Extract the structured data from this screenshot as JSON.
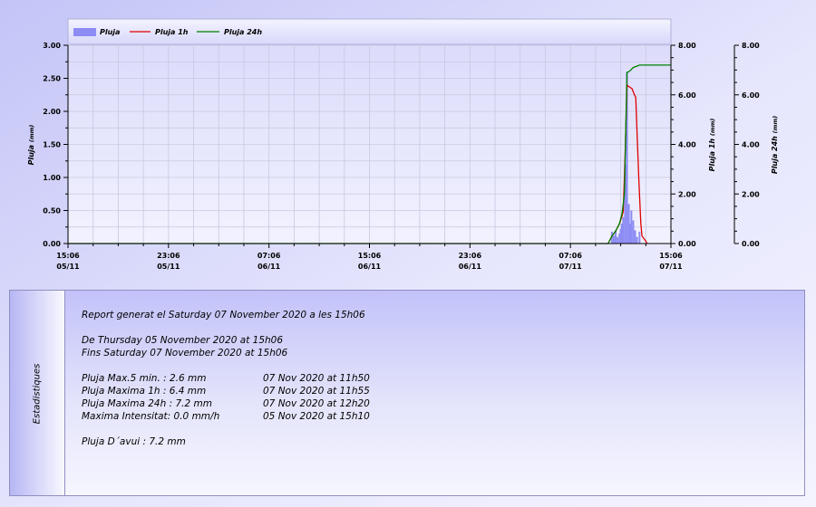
{
  "colors": {
    "bars": "#8c8cf4",
    "rain_1h": "#e00000",
    "rain_24h": "#008000",
    "grid": "#c8c8e0"
  },
  "chart_data": {
    "type": "bar+line",
    "x_tick_labels": [
      {
        "time": "15:06",
        "date": "05/11",
        "h": 0
      },
      {
        "time": "23:06",
        "date": "05/11",
        "h": 8
      },
      {
        "time": "07:06",
        "date": "06/11",
        "h": 16
      },
      {
        "time": "15:06",
        "date": "06/11",
        "h": 24
      },
      {
        "time": "23:06",
        "date": "06/11",
        "h": 32
      },
      {
        "time": "07:06",
        "date": "07/11",
        "h": 40
      },
      {
        "time": "15:06",
        "date": "07/11",
        "h": 48
      }
    ],
    "xlim_hours": [
      0,
      48
    ],
    "axes": [
      {
        "id": "left",
        "ylabel": "Pluja",
        "unit": "(mm)",
        "ylim": [
          0,
          3
        ],
        "ticks": [
          "0.00",
          "0.50",
          "1.00",
          "1.50",
          "2.00",
          "2.50",
          "3.00"
        ]
      },
      {
        "id": "right1",
        "ylabel": "Pluja 1h",
        "unit": "(mm)",
        "ylim": [
          0,
          8
        ],
        "ticks": [
          "0.00",
          "2.00",
          "4.00",
          "6.00",
          "8.00"
        ]
      },
      {
        "id": "right2",
        "ylabel": "Pluja 24h",
        "unit": "(mm)",
        "ylim": [
          0,
          8
        ],
        "ticks": [
          "0.00",
          "2.00",
          "4.00",
          "6.00",
          "8.00"
        ]
      }
    ],
    "legend_placement": "top",
    "grid": true,
    "series": [
      {
        "name": "Pluja",
        "type": "bar",
        "axis": "left",
        "x": [
          43.3,
          43.45,
          43.6,
          43.75,
          43.9,
          44.0,
          44.1,
          44.2,
          44.35,
          44.5,
          44.65,
          44.75,
          44.85,
          45.0,
          45.15,
          45.3,
          45.5
        ],
        "y": [
          0.18,
          0.12,
          0.2,
          0.1,
          0.15,
          0.22,
          0.3,
          0.4,
          1.2,
          2.6,
          0.6,
          0.3,
          0.5,
          0.35,
          0.2,
          0.1,
          0.18
        ]
      },
      {
        "name": "Pluja 1h",
        "type": "line",
        "axis": "right1",
        "x": [
          43.0,
          43.3,
          43.6,
          43.9,
          44.1,
          44.2,
          44.35,
          44.5,
          44.6,
          44.75,
          44.9,
          45.1,
          45.2,
          45.3,
          45.45,
          45.6,
          45.7,
          45.85,
          46.0,
          46.1
        ],
        "y": [
          0,
          0.3,
          0.5,
          0.8,
          1.1,
          1.3,
          3.5,
          6.4,
          6.35,
          6.3,
          6.25,
          6.0,
          5.9,
          4.5,
          2.5,
          0.8,
          0.3,
          0.2,
          0.1,
          0
        ]
      },
      {
        "name": "Pluja 24h",
        "type": "line",
        "axis": "right2",
        "x": [
          0,
          43.0,
          43.3,
          43.6,
          43.9,
          44.1,
          44.3,
          44.5,
          44.7,
          45.0,
          45.5,
          46.5,
          48.0
        ],
        "y": [
          0,
          0,
          0.3,
          0.5,
          0.8,
          1.2,
          2.0,
          6.9,
          6.95,
          7.1,
          7.2,
          7.2,
          7.2
        ]
      }
    ]
  },
  "stats": {
    "tab_label": "Estadistiques",
    "report": "Report generat el Saturday 07 November 2020 a les 15h06",
    "from": "De Thursday 05 November 2020 at 15h06",
    "to": "Fins Saturday 07 November 2020 at 15h06",
    "rows": [
      {
        "label": "Pluja Max.5 min. : 2.6 mm",
        "when": "07 Nov 2020 at 11h50"
      },
      {
        "label": "Pluja Maxima 1h  : 6.4 mm",
        "when": "07 Nov 2020 at 11h55"
      },
      {
        "label": "Pluja Maxima 24h : 7.2 mm",
        "when": "07 Nov 2020 at 12h20"
      },
      {
        "label": "Maxima Intensitat: 0.0 mm/h",
        "when": "05 Nov 2020 at 15h10"
      }
    ],
    "today": "Pluja D´avui : 7.2 mm"
  }
}
